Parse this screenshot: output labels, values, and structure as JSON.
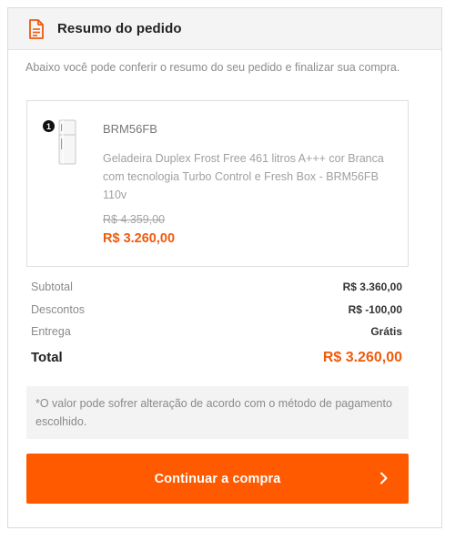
{
  "header": {
    "title": "Resumo do pedido",
    "icon": "document-icon"
  },
  "intro_text": "Abaixo você pode conferir o resumo do seu pedido e finalizar sua compra.",
  "product": {
    "quantity": "1",
    "sku": "BRM56FB",
    "description": "Geladeira Duplex Frost Free 461 litros A+++ cor Branca com tecnologia Turbo Control e Fresh Box - BRM56FB 110v",
    "old_price": "R$ 4.359,00",
    "price": "R$ 3.260,00"
  },
  "summary": {
    "subtotal_label": "Subtotal",
    "subtotal_value": "R$ 3.360,00",
    "discount_label": "Descontos",
    "discount_value": "R$ -100,00",
    "shipping_label": "Entrega",
    "shipping_value": "Grátis",
    "total_label": "Total",
    "total_value": "R$ 3.260,00"
  },
  "notice": "*O valor pode sofrer alteração de acordo com o método de pagamento escolhido.",
  "cta": {
    "label": "Continuar a compra",
    "icon": "chevron-right-icon"
  },
  "colors": {
    "accent": "#ff5a00",
    "price": "#f05a0c"
  }
}
